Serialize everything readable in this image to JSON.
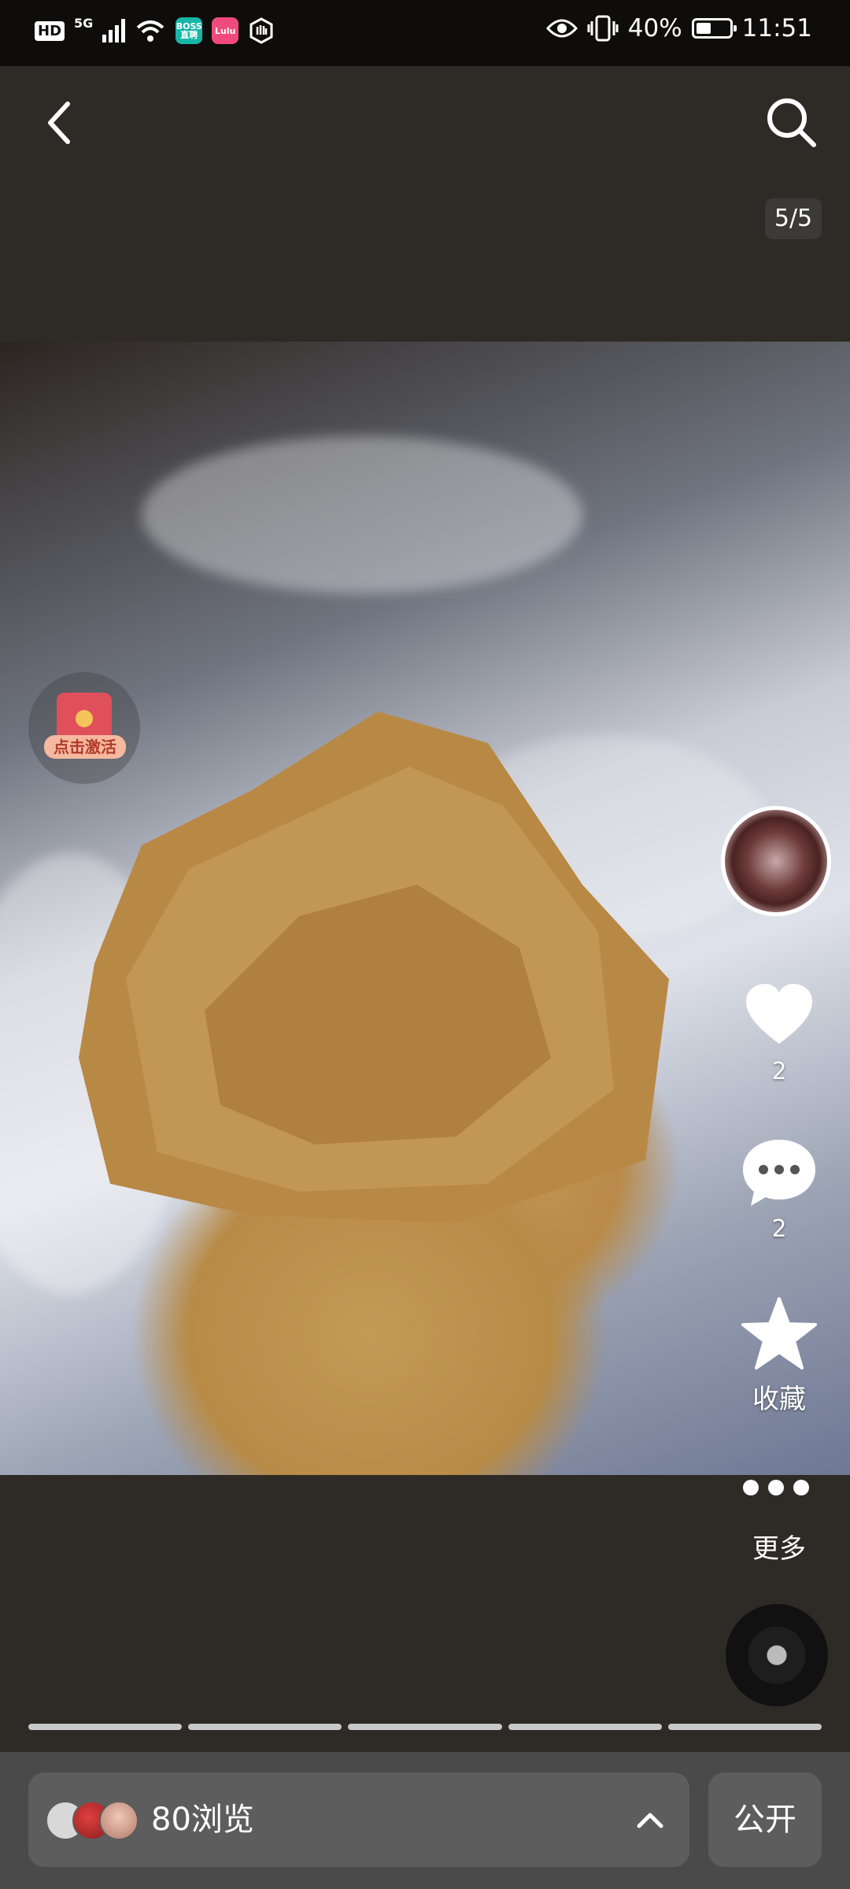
{
  "status_bar": {
    "network_badge": "HD",
    "signal_label": "5G",
    "app_badge_1": "BOSS直聘",
    "app_badge_2": "Lulu",
    "battery": "40%",
    "time": "11:51"
  },
  "header": {
    "back_icon": "chevron-left-icon",
    "search_icon": "search-icon",
    "page_indicator": "5/5"
  },
  "promo": {
    "label": "点击激活"
  },
  "actions": {
    "like_count": "2",
    "comment_count": "2",
    "favorite_label": "收藏",
    "more_label": "更多"
  },
  "progress": {
    "total_segments": 5,
    "current_segment": 5
  },
  "bottom": {
    "views_text": "80浏览",
    "public_button": "公开"
  },
  "colors": {
    "background": "#2e2a25",
    "bottom_bar": "#4a4a4a",
    "pill": "#5d5d5d"
  }
}
